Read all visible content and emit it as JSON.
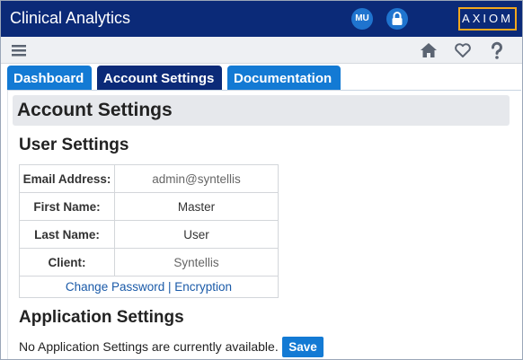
{
  "app": {
    "title": "Clinical Analytics",
    "user_initials": "MU",
    "brand": "AXIOM"
  },
  "toolbar": {
    "icons": [
      "menu-icon",
      "home-icon",
      "heart-icon",
      "help-icon"
    ]
  },
  "tabs": [
    {
      "label": "Dashboard",
      "active": false
    },
    {
      "label": "Account Settings",
      "active": true
    },
    {
      "label": "Documentation",
      "active": false
    }
  ],
  "page": {
    "title": "Account Settings"
  },
  "user_settings": {
    "title": "User Settings",
    "rows": [
      {
        "label": "Email Address:",
        "value": "admin@syntellis"
      },
      {
        "label": "First Name:",
        "value": "Master"
      },
      {
        "label": "Last Name:",
        "value": "User"
      },
      {
        "label": "Client:",
        "value": "Syntellis"
      }
    ],
    "change_password": "Change Password",
    "separator": "|",
    "encryption": "Encryption"
  },
  "application_settings": {
    "title": "Application Settings",
    "message": "No Application Settings are currently available.",
    "save_label": "Save"
  },
  "colors": {
    "titlebar": "#0b2a78",
    "tab": "#137ad4",
    "tab_active": "#0b2a78",
    "brand_border": "#f2a81d",
    "save": "#137ad4"
  }
}
